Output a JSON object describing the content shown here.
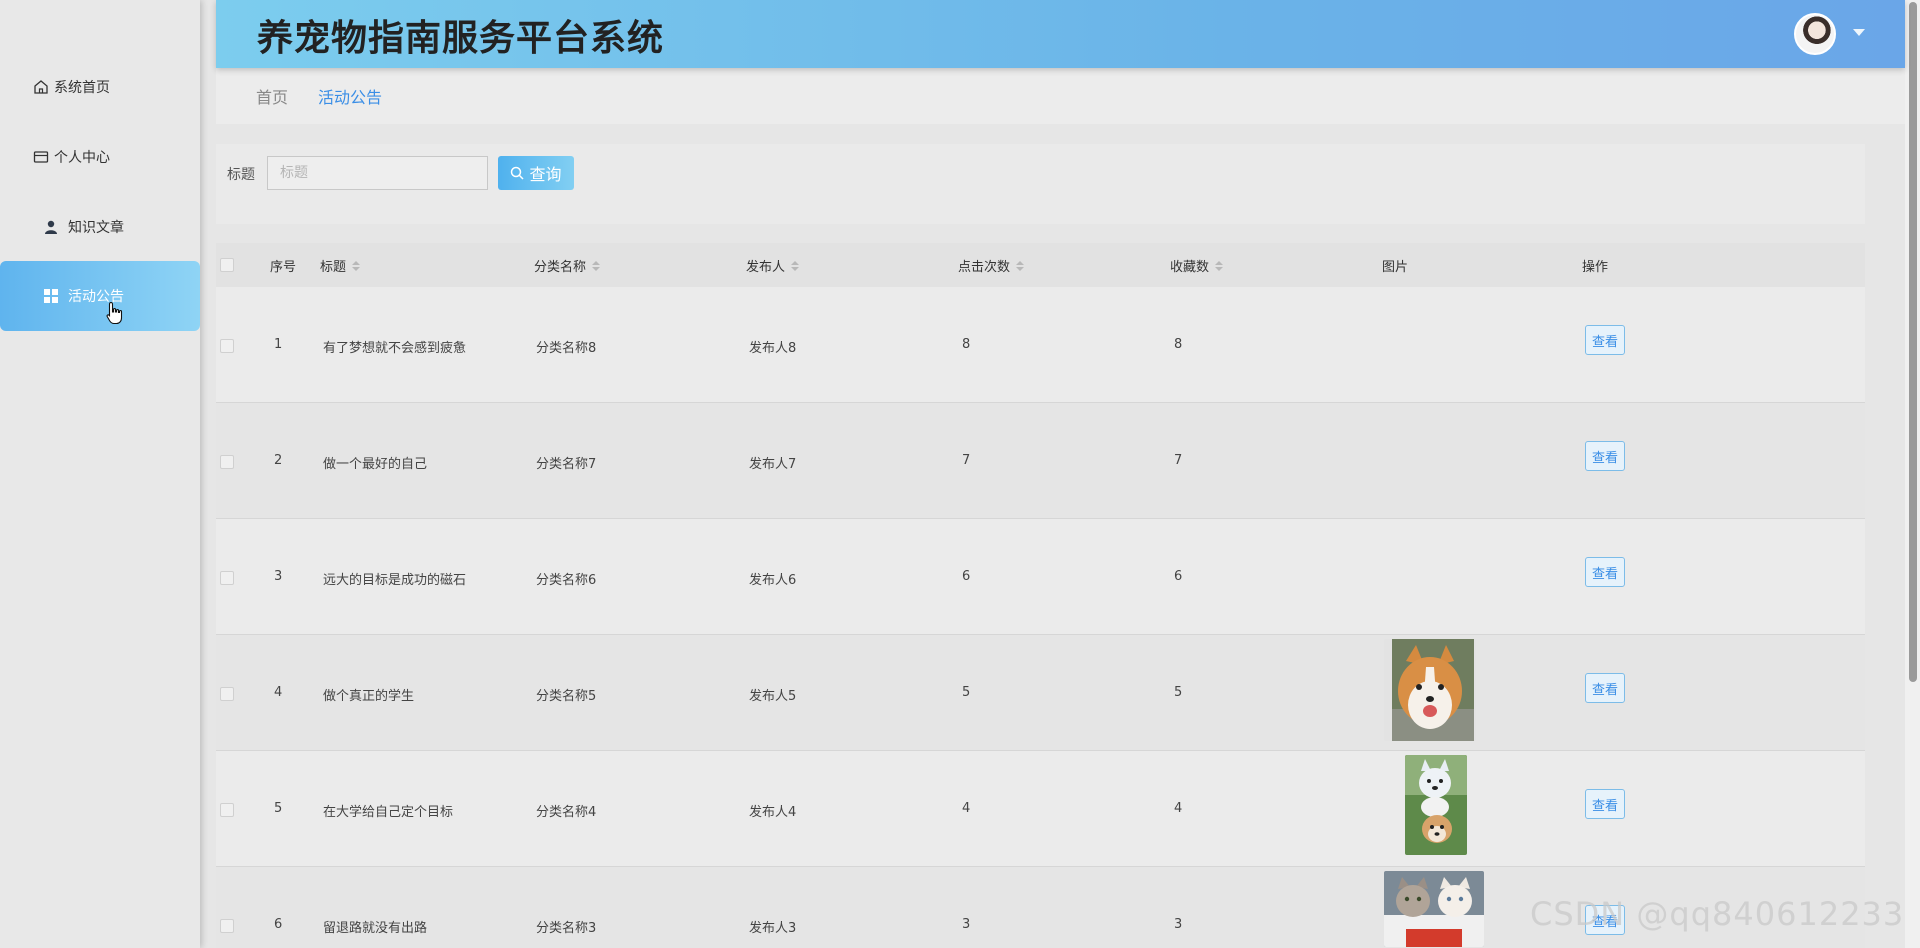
{
  "app": {
    "title": "养宠物指南服务平台系统"
  },
  "sidebar": {
    "items": [
      {
        "label": "系统首页",
        "icon": "home-icon"
      },
      {
        "label": "个人中心",
        "icon": "wallet-icon"
      },
      {
        "label": "知识文章",
        "icon": "user-icon"
      },
      {
        "label": "活动公告",
        "icon": "grid-icon",
        "active": true
      }
    ]
  },
  "breadcrumb": {
    "home": "首页",
    "current": "活动公告"
  },
  "search": {
    "label": "标题",
    "placeholder": "标题",
    "value": "",
    "button_label": "查询"
  },
  "table": {
    "columns": {
      "index": "序号",
      "title": "标题",
      "category": "分类名称",
      "publisher": "发布人",
      "clicks": "点击次数",
      "favorites": "收藏数",
      "image": "图片",
      "actions": "操作"
    },
    "view_label": "查看",
    "rows": [
      {
        "index": "1",
        "title": "有了梦想就不会感到疲惫",
        "category": "分类名称8",
        "publisher": "发布人8",
        "clicks": "8",
        "favorites": "8",
        "image": ""
      },
      {
        "index": "2",
        "title": "做一个最好的自己",
        "category": "分类名称7",
        "publisher": "发布人7",
        "clicks": "7",
        "favorites": "7",
        "image": ""
      },
      {
        "index": "3",
        "title": "远大的目标是成功的磁石",
        "category": "分类名称6",
        "publisher": "发布人6",
        "clicks": "6",
        "favorites": "6",
        "image": ""
      },
      {
        "index": "4",
        "title": "做个真正的学生",
        "category": "分类名称5",
        "publisher": "发布人5",
        "clicks": "5",
        "favorites": "5",
        "image": "corgi-photo"
      },
      {
        "index": "5",
        "title": "在大学给自己定个目标",
        "category": "分类名称4",
        "publisher": "发布人4",
        "clicks": "4",
        "favorites": "4",
        "image": "puppies-photo"
      },
      {
        "index": "6",
        "title": "留退路就没有出路",
        "category": "分类名称3",
        "publisher": "发布人3",
        "clicks": "3",
        "favorites": "3",
        "image": "kittens-photo"
      }
    ]
  },
  "watermark": "CSDN @qq840612233",
  "colors": {
    "header_start": "#7ccdee",
    "header_end": "#6aa6e8",
    "accent": "#3a8ee6",
    "active_menu": "#5fb4ee"
  }
}
